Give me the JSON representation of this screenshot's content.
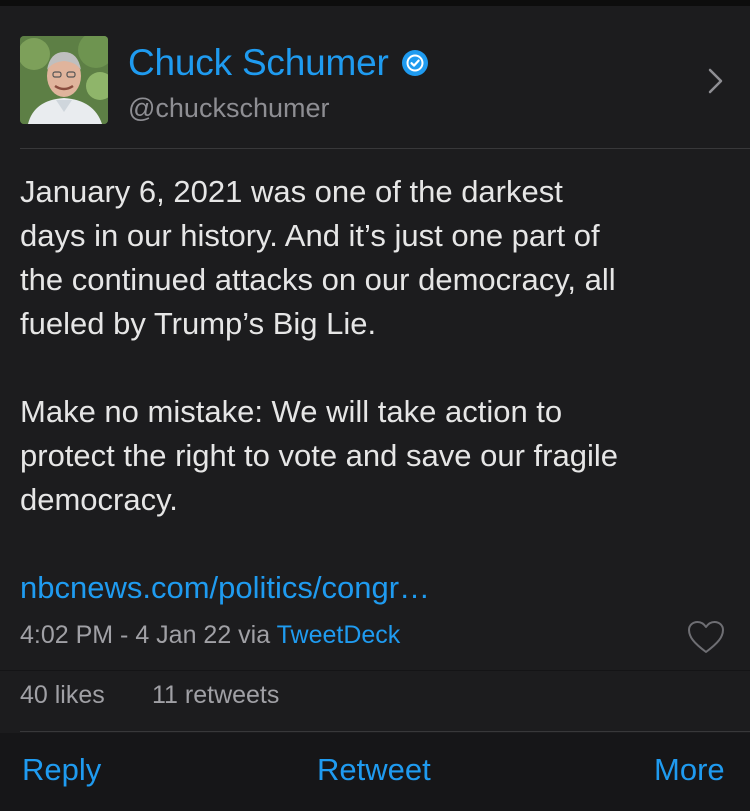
{
  "profile": {
    "name": "Chuck Schumer",
    "handle": "@chuckschumer",
    "verified": true,
    "avatar": "profile-photo",
    "chevron_icon": "chevron-right-icon",
    "verified_icon": "verified-badge-icon"
  },
  "tweet": {
    "text": "January 6, 2021 was one of the darkest\ndays in our history. And it’s just one part of\nthe continued attacks on our democracy, all\nfueled by Trump’s Big Lie.\n\nMake no mistake: We will take action to\nprotect the right to vote and save our fragile\ndemocracy.",
    "link": "nbcnews.com/politics/congr…",
    "time": "4:02 PM - 4 Jan 22 via ",
    "client": "TweetDeck",
    "like_icon": "heart-outline-icon"
  },
  "stats": {
    "likes": "40 likes",
    "retweets": "11 retweets"
  },
  "actions": {
    "reply": "Reply",
    "retweet": "Retweet",
    "more": "More"
  },
  "colors": {
    "accent": "#1f9bf0",
    "background": "#1c1c1e",
    "text": "#e6e6e6",
    "secondary_text": "#a0a0a5"
  }
}
